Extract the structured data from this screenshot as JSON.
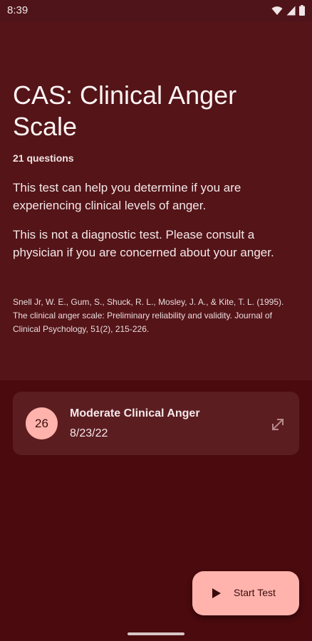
{
  "status_bar": {
    "time": "8:39",
    "icons": [
      "wifi-icon",
      "signal-icon",
      "battery-icon"
    ]
  },
  "test": {
    "title": "CAS: Clinical Anger Scale",
    "question_count": "21 questions",
    "description_1": "This test can help you determine if you are experiencing clinical levels of anger.",
    "description_2": "This is not a diagnostic test. Please consult a physician if you are concerned about your anger.",
    "citation": "Snell Jr, W. E., Gum, S., Shuck, R. L., Mosley, J. A., & Kite, T. L. (1995). The clinical anger scale: Preliminary reliability and validity. Journal of Clinical Psychology, 51(2), 215-226."
  },
  "result": {
    "score": "26",
    "label": "Moderate Clinical Anger",
    "date": "8/23/22",
    "icon": "expand-icon"
  },
  "fab": {
    "label": "Start Test",
    "icon": "play-icon"
  },
  "colors": {
    "background": "#4a0a0e",
    "header": "#541418",
    "card": "#5c1d21",
    "accent": "#ffb3ac"
  }
}
